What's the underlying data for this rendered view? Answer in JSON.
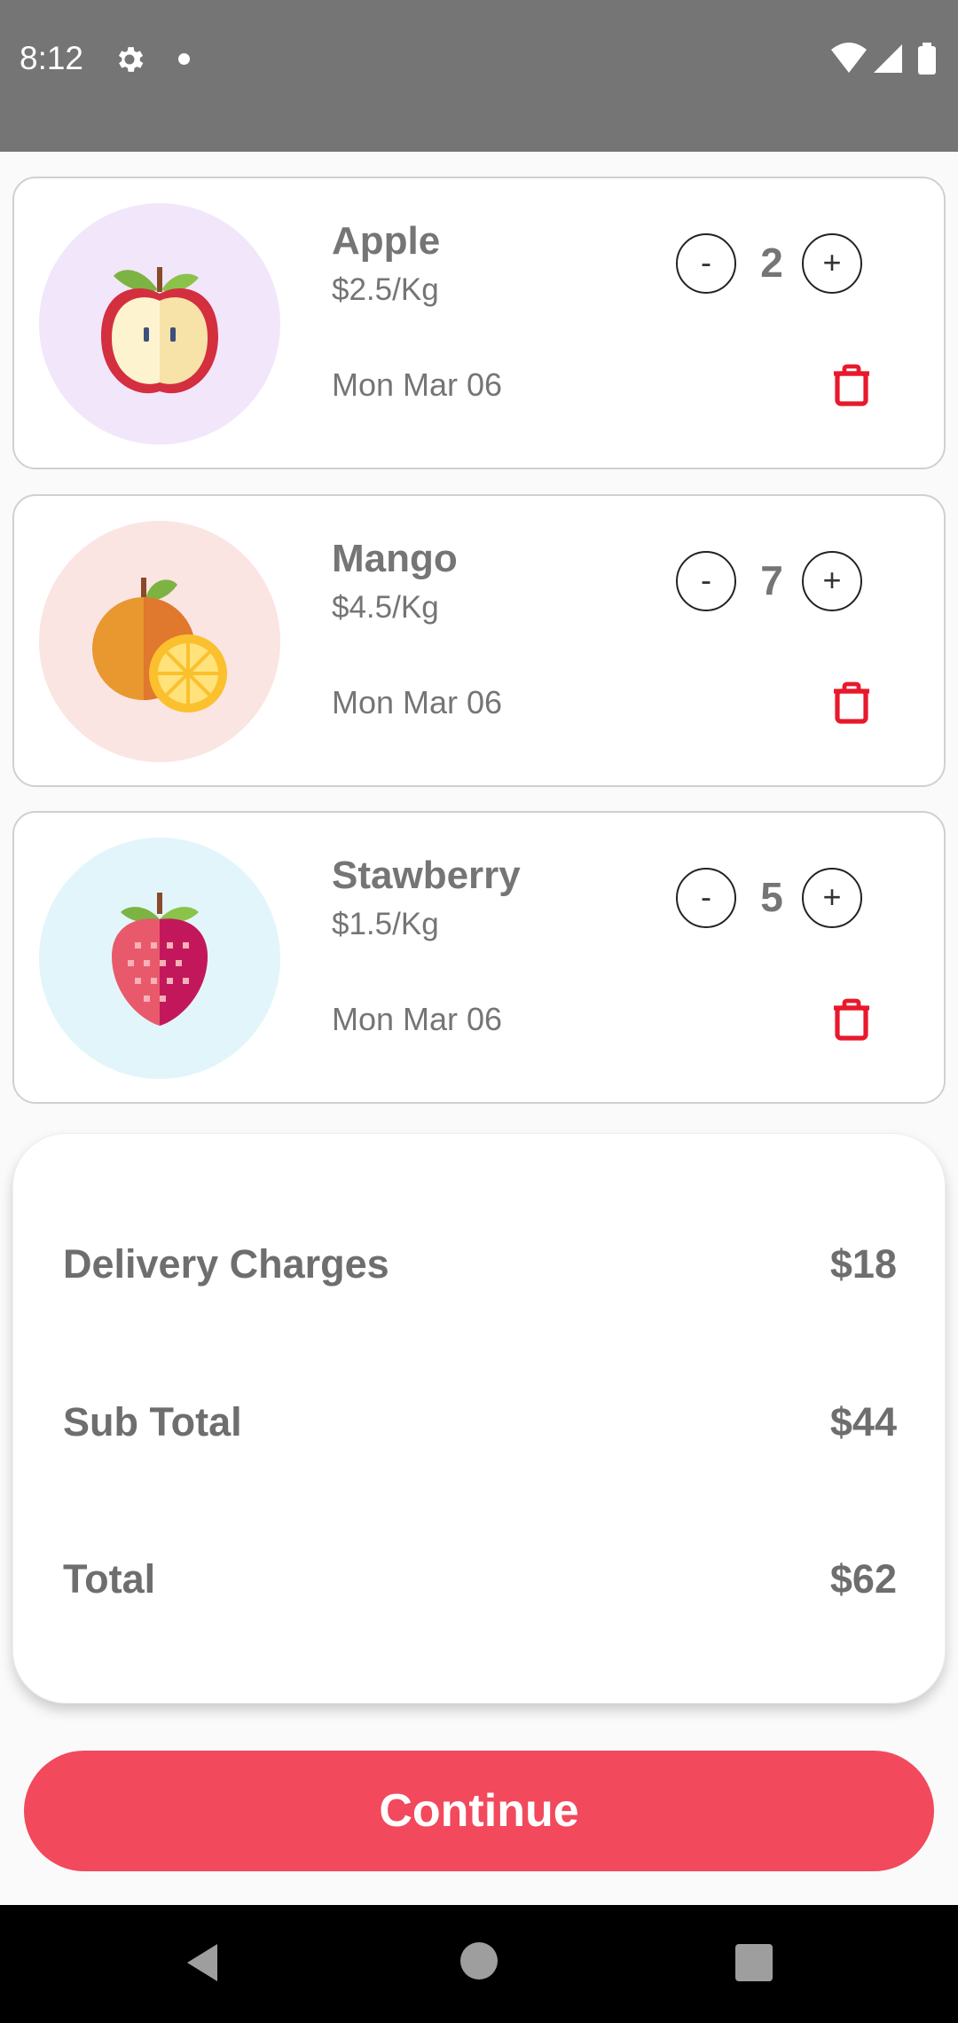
{
  "status_bar": {
    "time": "8:12",
    "icons": [
      "gear-icon",
      "notification-dot-icon",
      "wifi-icon",
      "signal-icon",
      "battery-icon"
    ]
  },
  "cart": {
    "items": [
      {
        "name": "Apple",
        "price": "$2.5/Kg",
        "date": "Mon Mar 06",
        "quantity": "2",
        "minus_label": "-",
        "plus_label": "+",
        "icon": "apple-icon",
        "bg_color": "#f2e6fb"
      },
      {
        "name": "Mango",
        "price": "$4.5/Kg",
        "date": "Mon Mar 06",
        "quantity": "7",
        "minus_label": "-",
        "plus_label": "+",
        "icon": "orange-icon",
        "bg_color": "#fae5e2"
      },
      {
        "name": "Stawberry",
        "price": "$1.5/Kg",
        "date": "Mon Mar 06",
        "quantity": "5",
        "minus_label": "-",
        "plus_label": "+",
        "icon": "strawberry-icon",
        "bg_color": "#e2f5fa"
      }
    ]
  },
  "summary": {
    "delivery_label": "Delivery Charges",
    "delivery_value": "$18",
    "subtotal_label": "Sub Total",
    "subtotal_value": "$44",
    "total_label": "Total",
    "total_value": "$62"
  },
  "continue_label": "Continue",
  "colors": {
    "accent": "#f2495c",
    "delete": "#e8192c",
    "text_gray": "#757575",
    "status_bar": "#757575"
  }
}
